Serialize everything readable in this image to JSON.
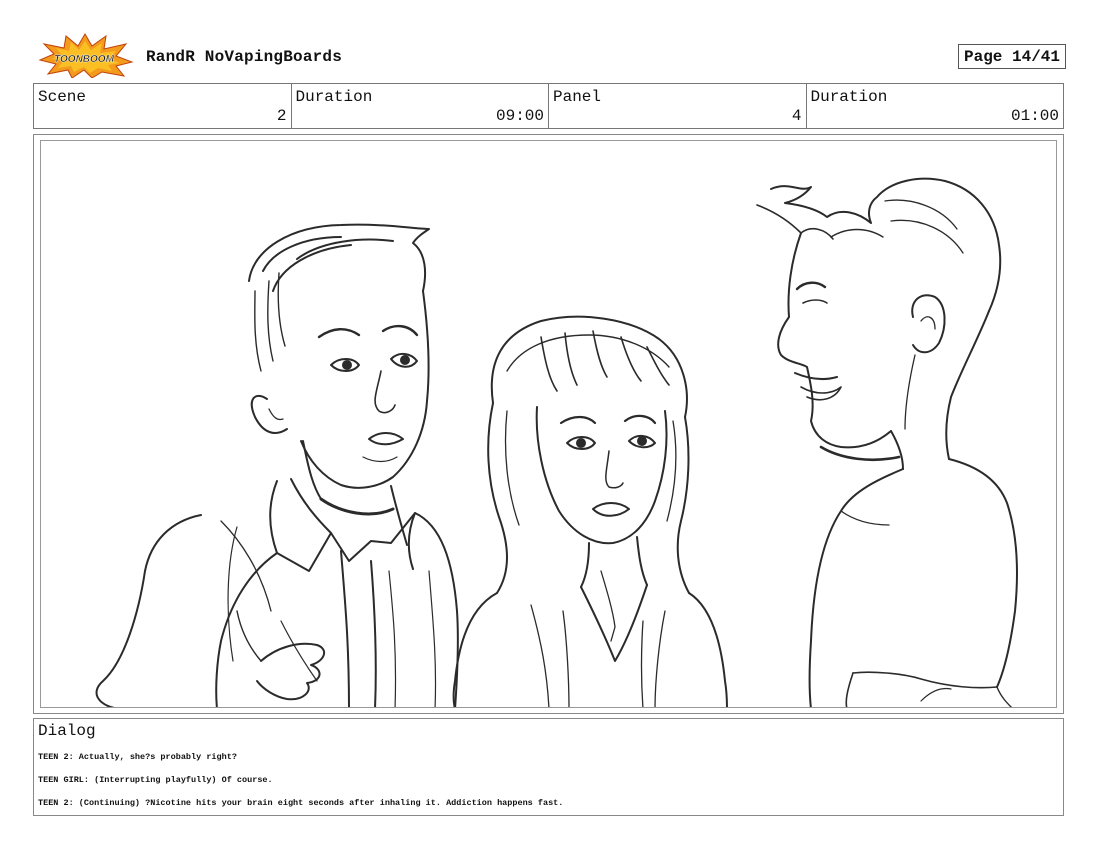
{
  "header": {
    "logo_text": "TOONBOOM",
    "title": "RandR NoVapingBoards",
    "page": "Page 14/41"
  },
  "info": {
    "scene_label": "Scene",
    "scene_value": "2",
    "duration_label": "Duration",
    "duration_value": "09:00",
    "panel_label": "Panel",
    "panel_value": "4",
    "panel_duration_label": "Duration",
    "panel_duration_value": "01:00"
  },
  "panel": {
    "characters": [
      "teen-2",
      "teen-girl",
      "teen-boy-smiling"
    ]
  },
  "dialog": {
    "label": "Dialog",
    "lines": [
      "TEEN 2: Actually, she?s probably right?",
      "TEEN GIRL: (Interrupting playfully) Of course.",
      "TEEN 2: (Continuing) ?Nicotine hits your brain eight seconds after inhaling it. Addiction happens fast."
    ]
  }
}
